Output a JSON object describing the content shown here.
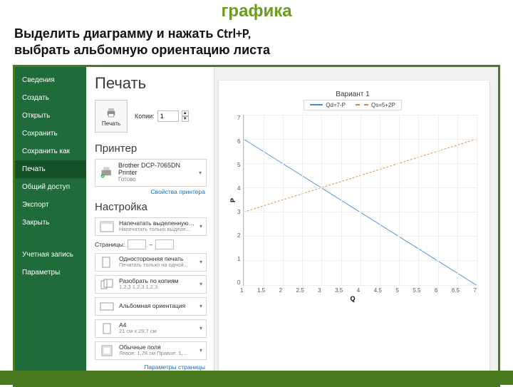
{
  "title_band": "графика",
  "caption_line1_a": "Выделить диаграмму и нажать ",
  "caption_kbd": "Ctrl+P,",
  "caption_line2": "выбрать альбомную ориентацию листа",
  "backstage": {
    "items": [
      "Сведения",
      "Создать",
      "Открыть",
      "Сохранить",
      "Сохранить как",
      "Печать",
      "Общий доступ",
      "Экспорт",
      "Закрыть"
    ],
    "account": "Учетная запись",
    "options": "Параметры",
    "active_index": 5
  },
  "print": {
    "heading": "Печать",
    "button_label": "Печать",
    "copies_label": "Копии:",
    "copies_value": "1"
  },
  "printer": {
    "heading": "Принтер",
    "name": "Brother DCP-7065DN Printer",
    "status": "Готово",
    "props_link": "Свойства принтера"
  },
  "setup": {
    "heading": "Настройка",
    "rows": [
      {
        "t1": "Напечатать выделенную д...",
        "t2": "Напечатать только выделе..."
      },
      {
        "t1": "Односторонняя печать",
        "t2": "Печатать только на одной..."
      },
      {
        "t1": "Разобрать по копиям",
        "t2": "1,2,3   1,2,3   1,2,3"
      },
      {
        "t1": "Альбомная ориентация",
        "t2": ""
      },
      {
        "t1": "A4",
        "t2": "21 см x 29,7 см"
      },
      {
        "t1": "Обычные поля",
        "t2": "Левое: 1,78 см  Правое: 1,..."
      }
    ],
    "pages_label": "Страницы:",
    "pages_sep": "–",
    "page_setup_link": "Параметры страницы"
  },
  "chart_data": {
    "type": "line",
    "title": "Вариант 1",
    "xlabel": "Q",
    "ylabel": "P",
    "x": [
      1,
      1.5,
      2,
      2.5,
      3,
      3.5,
      4,
      4.5,
      5,
      5.5,
      6,
      6.5,
      7
    ],
    "xlim": [
      1,
      7
    ],
    "ylim": [
      0,
      7
    ],
    "yticks": [
      0,
      1,
      2,
      3,
      4,
      5,
      6,
      7
    ],
    "series": [
      {
        "name": "Qd=7-P",
        "style": "solid",
        "color": "#4a8ed0",
        "points": [
          [
            1,
            6
          ],
          [
            7,
            0
          ]
        ]
      },
      {
        "name": "Qs=5+2P",
        "style": "dashed",
        "color": "#d58a3a",
        "points": [
          [
            1,
            3
          ],
          [
            7,
            6
          ]
        ]
      }
    ],
    "legend_position": "top"
  }
}
